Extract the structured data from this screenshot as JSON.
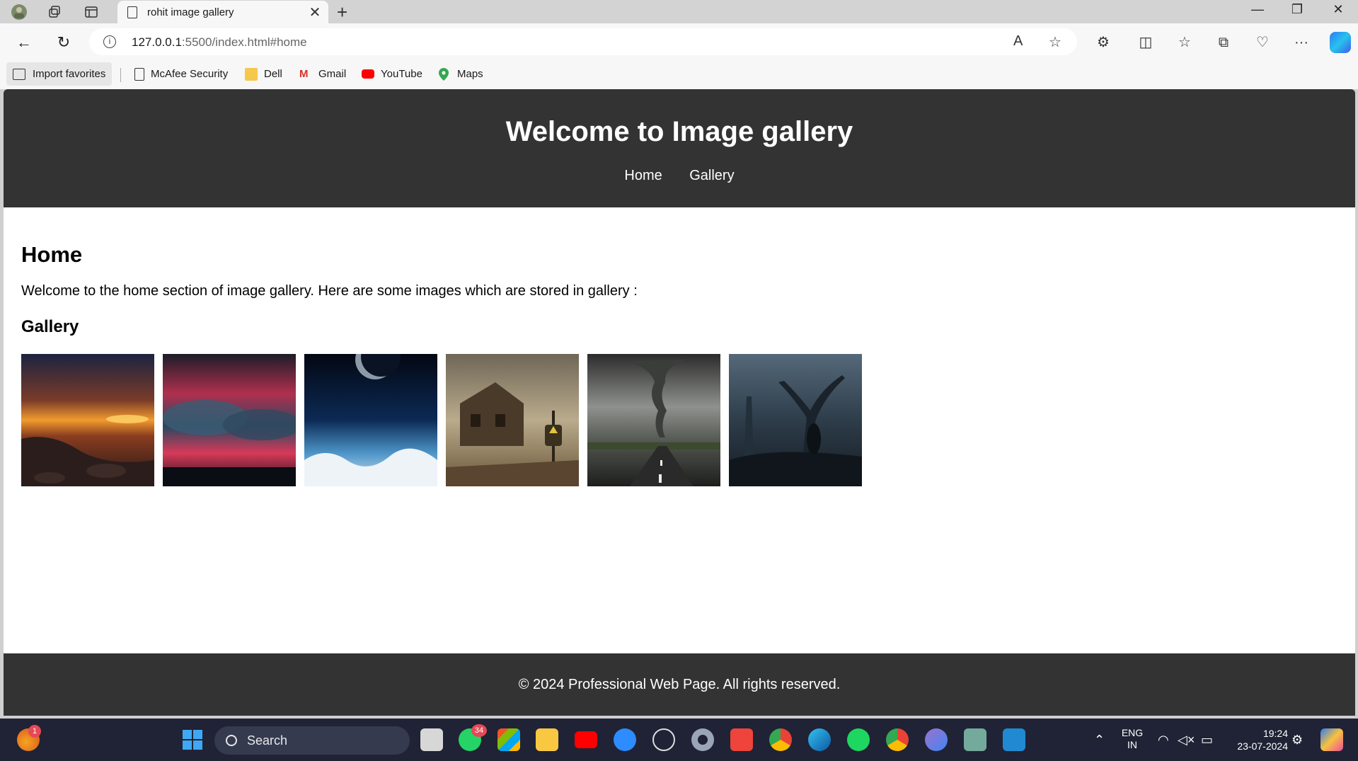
{
  "browser": {
    "tab_title": "rohit image gallery",
    "url_host": "127.0.0.1",
    "url_rest": ":5500/index.html#home",
    "favorites": {
      "import_label": "Import favorites",
      "items": [
        "McAfee Security",
        "Dell",
        "Gmail",
        "YouTube",
        "Maps"
      ]
    }
  },
  "page": {
    "header_title": "Welcome to Image gallery",
    "nav": [
      "Home",
      "Gallery"
    ],
    "section_title": "Home",
    "section_text": "Welcome to the home section of image gallery. Here are some images which are stored in gallery :",
    "gallery_title": "Gallery",
    "images": [
      "sunset beach",
      "red storm sky",
      "planet over clouds",
      "abandoned house",
      "tornado on road",
      "dark forest"
    ],
    "footer": "© 2024 Professional Web Page. All rights reserved."
  },
  "taskbar": {
    "search_label": "Search",
    "whatsapp_badge": "34",
    "notification_badge": "1",
    "lang_line1": "ENG",
    "lang_line2": "IN",
    "time": "19:24",
    "date": "23-07-2024"
  },
  "colors": {
    "header_bg": "#333333",
    "footer_bg": "#333333",
    "taskbar_bg": "#1f2335"
  }
}
